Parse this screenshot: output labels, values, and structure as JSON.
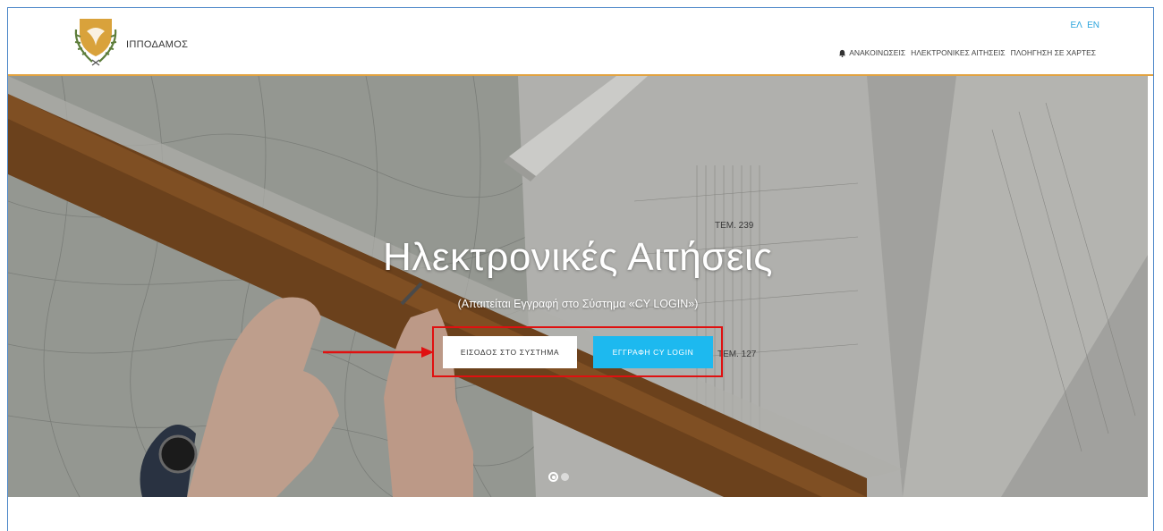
{
  "header": {
    "brand": "ΙΠΠΟΔΑΜΟΣ",
    "languages": [
      "ΕΛ",
      "EN"
    ],
    "nav": [
      {
        "label": "ΑΝΑΚΟΙΝΩΣΕΙΣ",
        "icon": "bell-icon"
      },
      {
        "label": "ΗΛΕΚΤΡΟΝΙΚΕΣ ΑΙΤΗΣΕΙΣ"
      },
      {
        "label": "ΠΛΟΗΓΗΣΗ ΣΕ ΧΑΡΤΕΣ"
      }
    ]
  },
  "hero": {
    "title": "Ηλεκτρονικές Αιτήσεις",
    "subtitle": "(Απαιτείται Εγγραφή στο Σύστημα «CY LOGIN»)",
    "login_button": "ΕΙΣΟΔΟΣ ΣΤΟ ΣΥΣΤΗΜΑ",
    "register_button": "ΕΓΓΡΑΦΗ CY LOGIN",
    "slides": 2,
    "active_slide": 1
  },
  "colors": {
    "accent_line": "#e2a341",
    "lang_link": "#2aa4dc",
    "register_button": "#1db9ef",
    "highlight": "#e01010",
    "frame_border": "#4a86c8"
  }
}
